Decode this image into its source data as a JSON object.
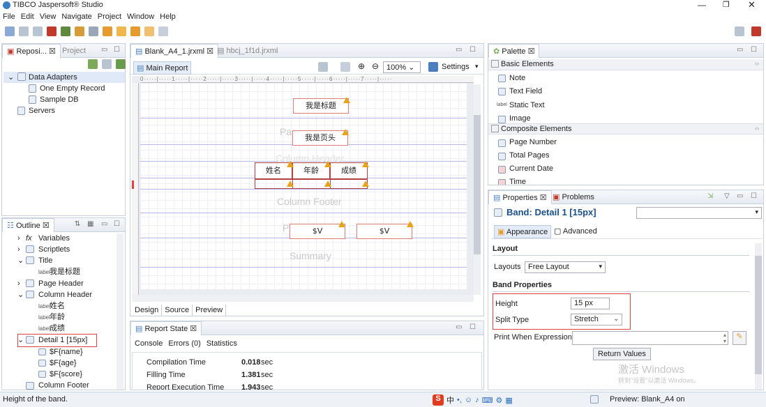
{
  "window": {
    "title": "TIBCO Jaspersoft® Studio"
  },
  "menu": [
    "File",
    "Edit",
    "View",
    "Navigate",
    "Project",
    "Window",
    "Help"
  ],
  "repo_panel": {
    "tabs": [
      "Reposi...",
      "Project"
    ],
    "tree": [
      "Data Adapters",
      "One Empty Record",
      "Sample DB",
      "Servers"
    ]
  },
  "outline": {
    "tab": "Outline",
    "items": [
      {
        "label": "Variables",
        "prefix": "fx"
      },
      {
        "label": "Scriptlets"
      },
      {
        "label": "Title"
      },
      {
        "label": "我是标题"
      },
      {
        "label": "Page Header"
      },
      {
        "label": "Column Header"
      },
      {
        "label": "姓名"
      },
      {
        "label": "年龄"
      },
      {
        "label": "成绩"
      },
      {
        "label": "Detail 1 [15px]"
      },
      {
        "label": "$F{name}"
      },
      {
        "label": "$F{age}"
      },
      {
        "label": "$F{score}"
      },
      {
        "label": "Column Footer"
      }
    ]
  },
  "editor": {
    "tabs": [
      "Blank_A4_1.jrxml",
      "hbcj_1f1d.jrxml"
    ],
    "subtab": "Main Report",
    "zoom": "100%",
    "settings": "Settings",
    "bands": {
      "title_box": "我是标题",
      "page_header_box": "我是页头",
      "col_h": [
        "姓名",
        "年龄",
        "成绩"
      ],
      "column_footer": "Column Footer",
      "summary": "Summary",
      "page_footer_v1": "$V",
      "page_footer_v2": "$V",
      "ghost_page": "Pa",
      "ghost_col": "Column Header",
      "ghost_pf": "P"
    },
    "bottom_tabs": [
      "Design",
      "Source",
      "Preview"
    ]
  },
  "report_state": {
    "tab": "Report State",
    "subtabs": [
      "Console",
      "Errors (0)",
      "Statistics"
    ],
    "rows": [
      {
        "label": "Compilation Time",
        "value": "0.018",
        "unit": "sec"
      },
      {
        "label": "Filling Time",
        "value": "1.381",
        "unit": "sec"
      },
      {
        "label": "Report Execution Time",
        "value": "1.943",
        "unit": "sec"
      }
    ]
  },
  "palette": {
    "tab": "Palette",
    "basic_title": "Basic Elements",
    "basic": [
      "Note",
      "Text Field",
      "Static Text",
      "Image"
    ],
    "composite_title": "Composite Elements",
    "composite": [
      "Page Number",
      "Total Pages",
      "Current Date",
      "Time"
    ]
  },
  "properties": {
    "tabs": [
      "Properties",
      "Problems"
    ],
    "band_title": "Band: Detail 1 [15px]",
    "subtabs": [
      "Appearance",
      "Advanced"
    ],
    "layout_section": "Layout",
    "layouts_label": "Layouts",
    "layouts_value": "Free Layout",
    "band_section": "Band Properties",
    "height_label": "Height",
    "height_value": "15 px",
    "split_label": "Split Type",
    "split_value": "Stretch",
    "pwe_label": "Print When Expression",
    "return_values": "Return Values"
  },
  "status": {
    "text": "Height of the band.",
    "preview": "Preview: Blank_A4 on",
    "watermark1": "激活 Windows",
    "watermark2": "转到\"设置\"以激活 Windows。"
  },
  "colors": {
    "accent": "#1a4f8a",
    "red": "#e04040",
    "guide": "#b8b8e8"
  }
}
